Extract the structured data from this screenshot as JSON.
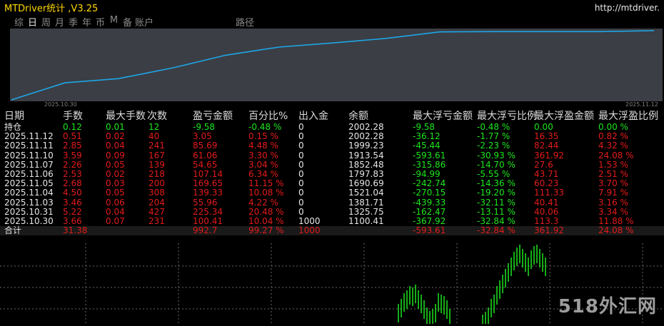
{
  "header": {
    "title": "MTDriver统计 ,V3.25",
    "url": "http://mtdriver."
  },
  "toolbar": {
    "tabs": [
      "综",
      "日",
      "周",
      "月",
      "季",
      "年",
      "币",
      "M",
      "备",
      "账户"
    ],
    "extra": "路径",
    "active": "日"
  },
  "equity_chart": {
    "x_start": "2025.10.30",
    "x_end": "2025.11.12",
    "values": [
      1100.41,
      1325.75,
      1381.71,
      1521.04,
      1690.69,
      1797.83,
      1852.48,
      1913.54,
      1999.23,
      2002.28,
      2002.28,
      2002.28,
      2015
    ],
    "line_color": "#1ea6e6",
    "bg_color": "#3b3e45"
  },
  "table": {
    "headers": [
      "日期",
      "手数",
      "最大手数",
      "次数",
      "盈亏金额",
      "百分比%",
      "出入金",
      "余额",
      "最大浮亏金额",
      "最大浮亏比例",
      "最大浮盈金额",
      "最大浮盈比例"
    ],
    "hold_row": {
      "label": "持仓",
      "cells": [
        "0.12",
        "0.01",
        "12",
        "-9.58",
        "-0.48 %",
        "0",
        "2002.28",
        "-9.58",
        "-0.48 %",
        "0.00",
        "0.00 %"
      ]
    },
    "rows": [
      [
        "2025.11.12",
        "0.51",
        "0.02",
        "40",
        "3.05",
        "0.15 %",
        "0",
        "2002.28",
        "-36.12",
        "-1.77 %",
        "16.35",
        "0.82 %"
      ],
      [
        "2025.11.11",
        "2.85",
        "0.04",
        "241",
        "85.69",
        "4.48 %",
        "0",
        "1999.23",
        "-45.44",
        "-2.23 %",
        "82.44",
        "4.32 %"
      ],
      [
        "2025.11.10",
        "3.59",
        "0.09",
        "167",
        "61.06",
        "3.30 %",
        "0",
        "1913.54",
        "-593.61",
        "-30.93 %",
        "361.92",
        "24.08 %"
      ],
      [
        "2025.11.07",
        "2.26",
        "0.05",
        "139",
        "54.65",
        "3.04 %",
        "0",
        "1852.48",
        "-315.86",
        "-14.70 %",
        "27.6",
        "1.53 %"
      ],
      [
        "2025.11.06",
        "2.53",
        "0.02",
        "218",
        "107.14",
        "6.34 %",
        "0",
        "1797.83",
        "-94.99",
        "-5.55 %",
        "43.71",
        "2.51 %"
      ],
      [
        "2025.11.05",
        "2.68",
        "0.03",
        "200",
        "169.65",
        "11.15 %",
        "0",
        "1690.69",
        "-242.74",
        "-14.36 %",
        "60.23",
        "3.70 %"
      ],
      [
        "2025.11.04",
        "4.50",
        "0.05",
        "308",
        "139.33",
        "10.08 %",
        "0",
        "1521.04",
        "-270.15",
        "-19.20 %",
        "111.33",
        "7.91 %"
      ],
      [
        "2025.11.03",
        "3.46",
        "0.06",
        "204",
        "55.96",
        "4.22 %",
        "0",
        "1381.71",
        "-439.33",
        "-32.11 %",
        "40.41",
        "3.16 %"
      ],
      [
        "2025.10.31",
        "5.22",
        "0.04",
        "427",
        "225.34",
        "20.48 %",
        "0",
        "1325.75",
        "-162.47",
        "-13.11 %",
        "40.06",
        "3.34 %"
      ],
      [
        "2025.10.30",
        "3.66",
        "0.07",
        "231",
        "100.41",
        "10.04 %",
        "1000",
        "1100.41",
        "-367.92",
        "-32.84 %",
        "113.3",
        "11.88 %"
      ]
    ],
    "total_row": {
      "label": "合计",
      "cells": [
        "31.38",
        "",
        "",
        "992.7",
        "99.27 %",
        "1000",
        "",
        "-593.61",
        "-32.84 %",
        "361.92",
        "24.08 %"
      ]
    }
  },
  "price_chart": {
    "bar_color": "#1ee61e",
    "grid_color": "#666666"
  },
  "watermark": "518外汇网"
}
